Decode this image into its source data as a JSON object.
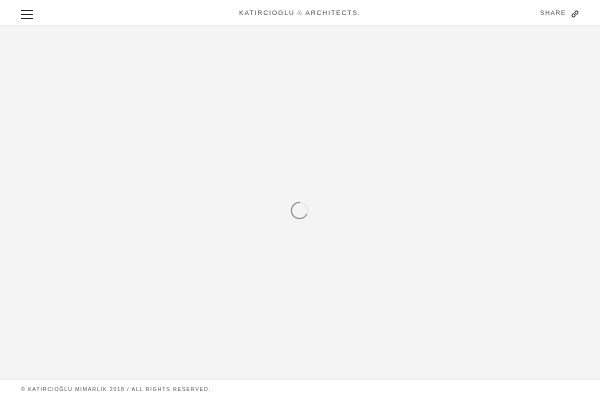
{
  "header": {
    "menu_icon": "hamburger-menu-icon",
    "logo": {
      "left": "KATIRCIOGLU",
      "ampersand": "&",
      "right": "ARCHITECTS."
    },
    "share": {
      "label": "SHARE",
      "icon": "share-link-icon"
    }
  },
  "main": {
    "loader_icon": "loading-spinner-icon"
  },
  "footer": {
    "copyright": "© KATIRCIOĞLU MIMARLIK 2018 / ALL RIGHTS RESERVED."
  },
  "colors": {
    "background": "#f4f4f4",
    "bar": "#ffffff",
    "text": "#444444"
  }
}
